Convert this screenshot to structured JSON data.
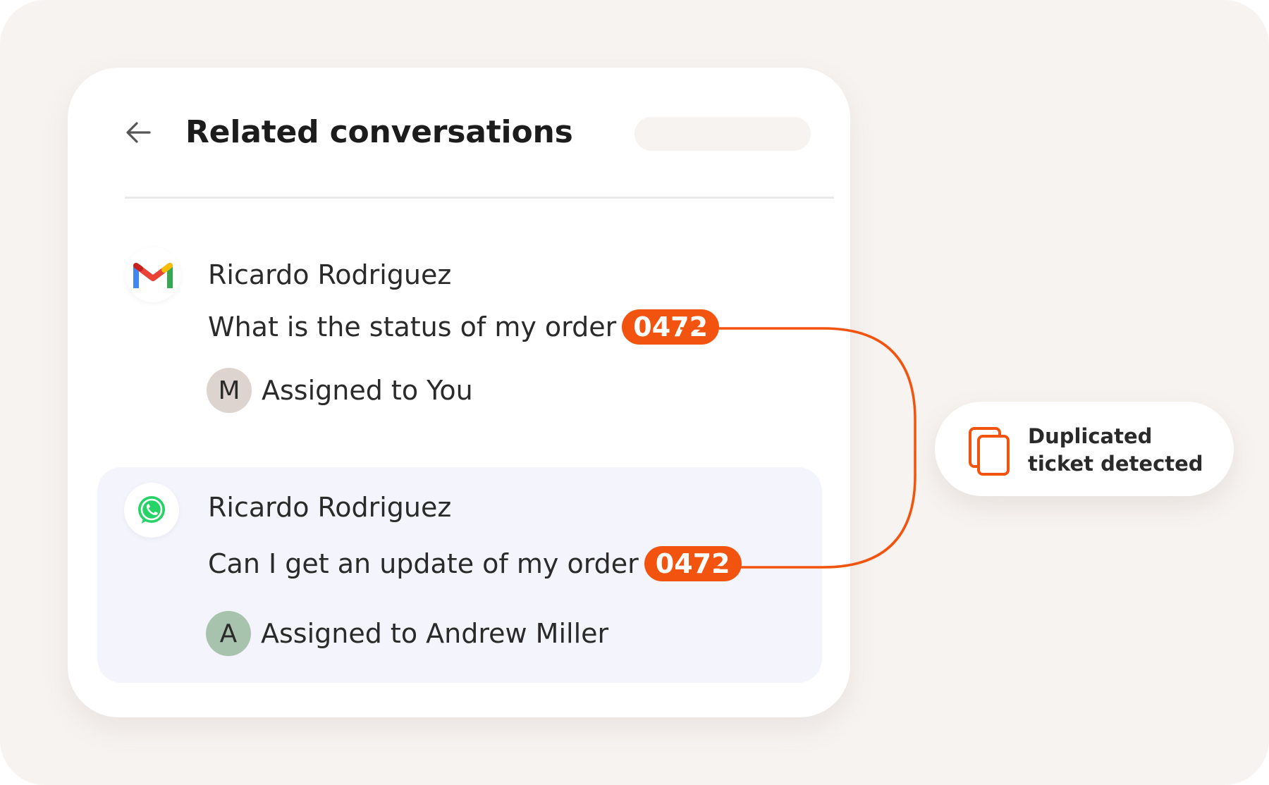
{
  "header": {
    "title": "Related conversations",
    "back_icon": "arrow-left-icon"
  },
  "conversations": [
    {
      "channel": "gmail-icon",
      "sender": "Ricardo Rodriguez",
      "message": "What is the status of my order",
      "order_id": "0472",
      "avatar_letter": "M",
      "assignment": "Assigned to You",
      "highlighted": false
    },
    {
      "channel": "whatsapp-icon",
      "sender": "Ricardo Rodriguez",
      "message": "Can I get an update of my order",
      "order_id": "0472",
      "avatar_letter": "A",
      "assignment": "Assigned to Andrew Miller",
      "highlighted": true
    }
  ],
  "notification": {
    "icon": "copy-icon",
    "text": "Duplicated ticket detected"
  },
  "colors": {
    "accent": "#f25410",
    "background": "#f7f3f0",
    "highlight_row": "#f4f4fc",
    "avatar_m": "#ddd4d0",
    "avatar_a": "#a7c2ad"
  }
}
